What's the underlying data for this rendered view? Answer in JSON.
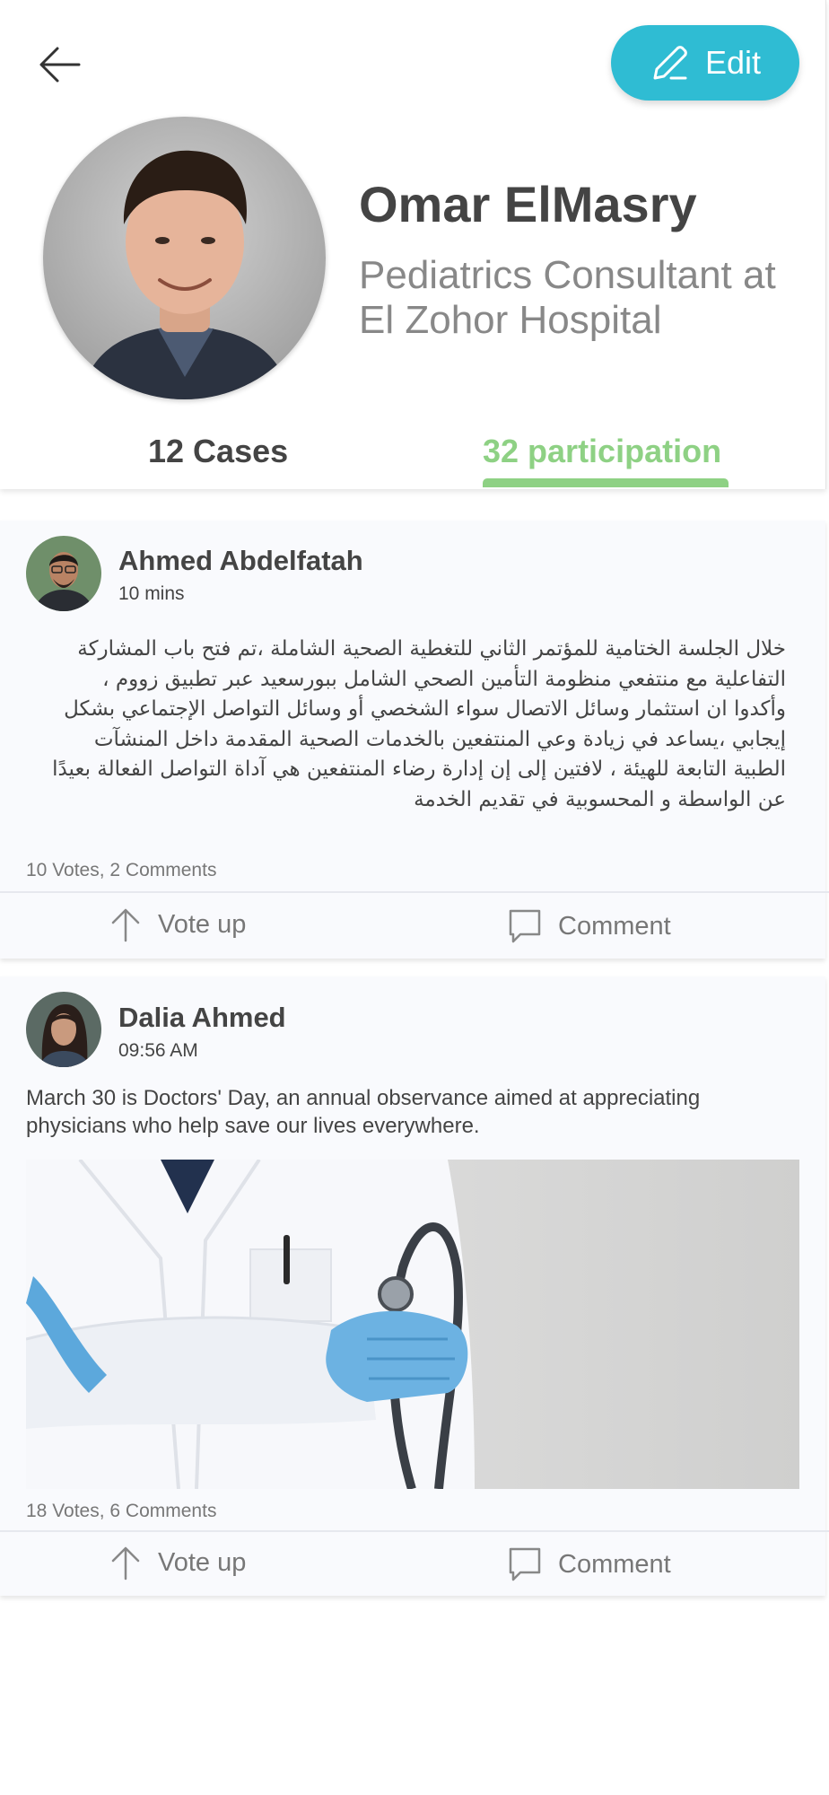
{
  "header": {
    "back_icon": "arrow-left-icon",
    "edit_label": "Edit",
    "edit_icon": "pencil-icon",
    "accent": "#2fbcd3"
  },
  "profile": {
    "name": "Omar ElMasry",
    "title": "Pediatrics Consultant at El Zohor Hospital"
  },
  "tabs": [
    {
      "label": "12 Cases",
      "active": false
    },
    {
      "label": "32 participation",
      "active": true,
      "color": "#8ed184"
    }
  ],
  "posts": [
    {
      "author": "Ahmed Abdelfatah",
      "time": "10 mins",
      "text": "خلال الجلسة الختامية للمؤتمر الثاني للتغطية الصحية الشاملة ،تم فتح باب المشاركة التفاعلية مع منتفعي منظومة التأمين الصحي الشامل ببورسعيد عبر تطبيق زووم ، وأكدوا ان استثمار وسائل الاتصال سواء الشخصي أو وسائل التواصل الإجتماعي بشكل إيجابي ،يساعد في زيادة وعي المنتفعين بالخدمات الصحية المقدمة داخل المنشآت الطبية التابعة للهيئة ، لافتين إلى إن إدارة رضاء المنتفعين هي آداة التواصل الفعالة بعيدًا عن الواسطة و المحسوبية في تقديم الخدمة",
      "stats": "10 Votes, 2 Comments",
      "vote_label": "Vote up",
      "comment_label": "Comment"
    },
    {
      "author": "Dalia Ahmed",
      "time": "09:56 AM",
      "text": "March 30 is Doctors' Day, an annual observance aimed at appreciating physicians who help save our lives everywhere.",
      "stats": "18 Votes, 6 Comments",
      "vote_label": "Vote up",
      "comment_label": "Comment"
    }
  ]
}
